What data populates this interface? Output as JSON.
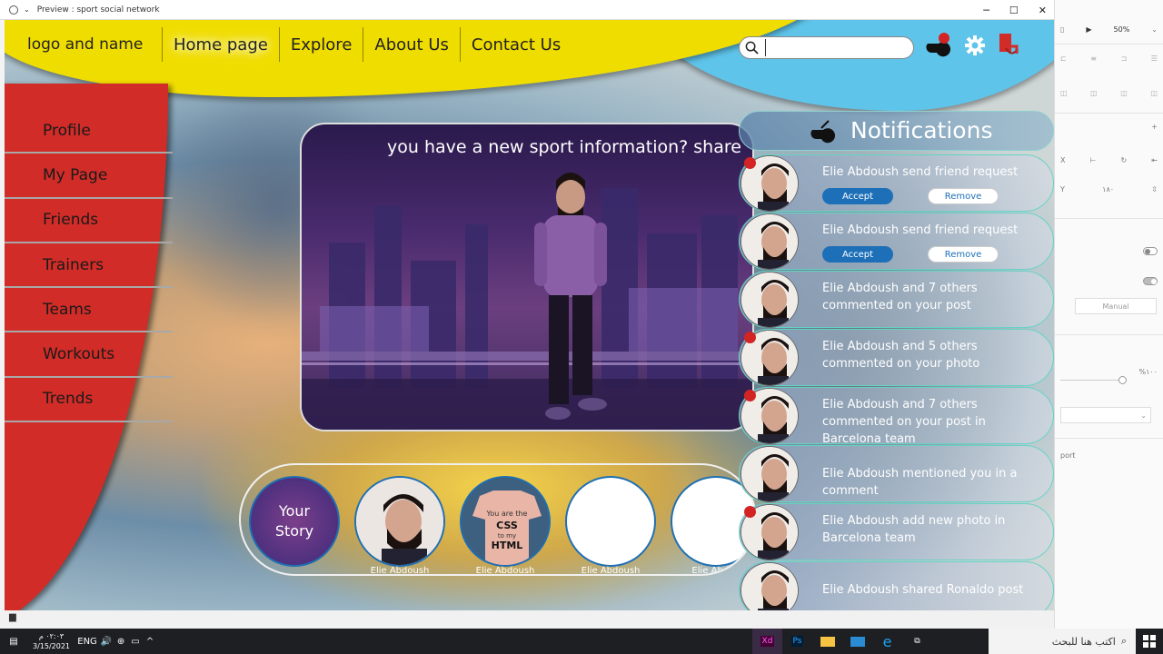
{
  "window": {
    "title": "Preview : sport social network",
    "minimize": "─",
    "maximize": "☐",
    "close": "✕"
  },
  "header": {
    "logo": "logo and name",
    "nav": [
      "Home page",
      "Explore",
      "About Us",
      "Contact Us"
    ],
    "search_value": ""
  },
  "sidebar": {
    "items": [
      "Profile",
      "My Page",
      "Friends",
      "Trainers",
      "Teams",
      "Workouts",
      "Trends"
    ]
  },
  "post": {
    "prompt": "you have a new sport information? share"
  },
  "stories": {
    "your_story": "Your Story",
    "items": [
      "Elie Abdoush",
      "Elie Abdoush",
      "Elie Abdoush",
      "Elie Abdou"
    ]
  },
  "notifications": {
    "title": "Notifications",
    "accept_label": "Accept",
    "remove_label": "Remove",
    "items": [
      {
        "text": "Elie Abdoush send friend request",
        "unread": true,
        "actions": true
      },
      {
        "text": "Elie Abdoush send friend request",
        "unread": false,
        "actions": true
      },
      {
        "text": "Elie Abdoush and 7 others commented on your post",
        "unread": false,
        "actions": false
      },
      {
        "text": "Elie Abdoush and 5 others commented on your photo",
        "unread": true,
        "actions": false
      },
      {
        "text": "Elie Abdoush and 7 others commented on your post in Barcelona team",
        "unread": true,
        "actions": false
      },
      {
        "text": "Elie Abdoush mentioned you in a comment",
        "unread": false,
        "actions": false
      },
      {
        "text": "Elie Abdoush add new photo in Barcelona team",
        "unread": true,
        "actions": false
      },
      {
        "text": "Elie Abdoush shared Ronaldo post",
        "unread": false,
        "actions": false
      }
    ]
  },
  "xd_panel": {
    "zoom": "50%",
    "x_label": "X",
    "y_label": "Y",
    "y_value": "١٨٠",
    "manual": "Manual",
    "percent": "%١٠٠",
    "port": "port"
  },
  "taskbar": {
    "time": "٠٢:٠٣ م",
    "date": "3/15/2021",
    "lang": "ENG",
    "search_placeholder": "اكتب هنا للبحث"
  },
  "colors": {
    "yellow": "#f0dd00",
    "blue": "#5fc4ea",
    "red": "#d12c27",
    "accent": "#1d6fb8"
  }
}
